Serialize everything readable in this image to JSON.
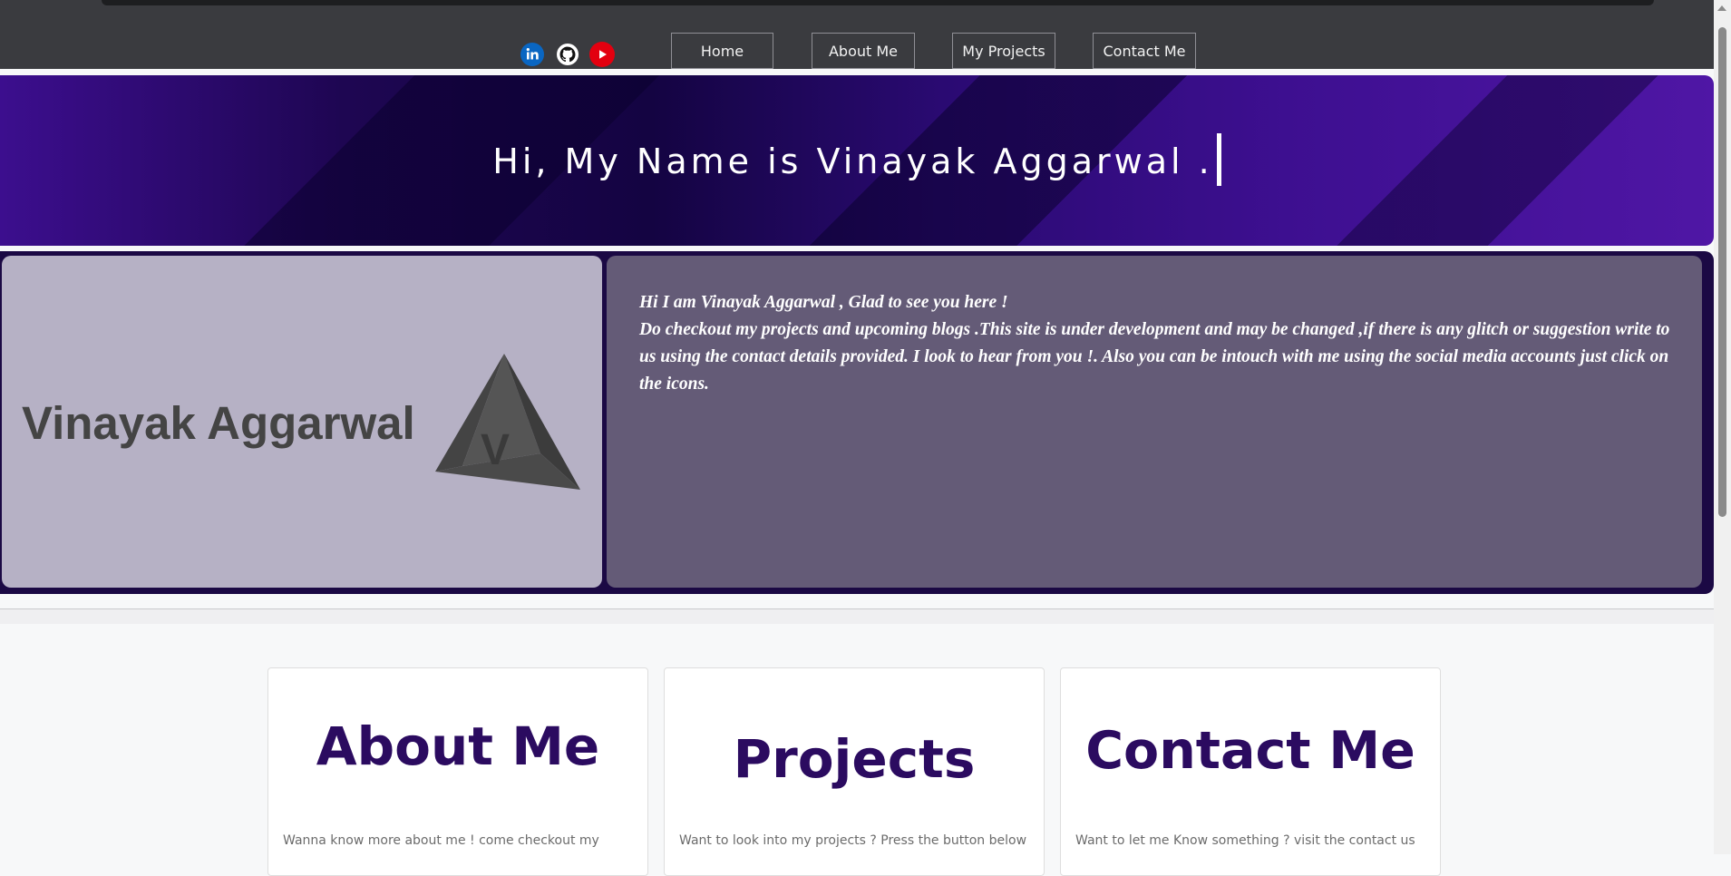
{
  "social": {
    "linkedin": {
      "icon": "linkedin-icon",
      "color": "#0a66c2"
    },
    "github": {
      "icon": "github-icon",
      "color": "#ffffff"
    },
    "youtube": {
      "icon": "youtube-icon",
      "color": "#e3000f"
    }
  },
  "nav": {
    "home": "Home",
    "about": "About Me",
    "projects": "My Projects",
    "contact": "Contact Me"
  },
  "hero": {
    "title": "Hi, My Name is Vinayak Aggarwal ."
  },
  "intro": {
    "logo_text": "Vinayak Aggarwal",
    "logo_letter": "V",
    "line1": "Hi I am Vinayak Aggarwal , Glad to see you here !",
    "line2": "Do checkout my projects and upcoming blogs .This site is under development and may be changed ,if there is any glitch or suggestion write to us using the contact details provided. I look to hear from you !. Also you can be intouch with me using the social media accounts just click on the icons."
  },
  "cards": [
    {
      "title": "About Me",
      "text": "Wanna know more about me ! come checkout my"
    },
    {
      "title": "Projects",
      "text": "Want to look into my projects ? Press the button below"
    },
    {
      "title": "Contact Me",
      "text": "Want to let me Know something ? visit the contact us"
    }
  ],
  "colors": {
    "accent": "#2b0b60",
    "nav_bg": "#3a3b3f",
    "intro_bg": "#1b0944"
  }
}
